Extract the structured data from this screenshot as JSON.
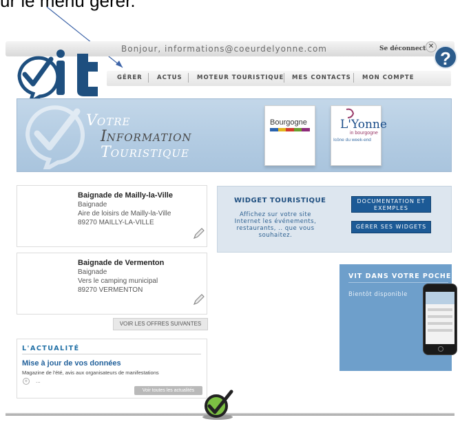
{
  "annotation": {
    "caption": "ur le menu gérer."
  },
  "header": {
    "greeting": "Bonjour, informations@coeurdelyonne.com",
    "logout_label": "Se déconnecter",
    "logout_icon": "close-icon",
    "help_label": "?",
    "logo_text": "Vit"
  },
  "nav": {
    "items": [
      {
        "label": "GÉRER"
      },
      {
        "label": "ACTUS"
      },
      {
        "label": "MOTEUR TOURISTIQUE"
      },
      {
        "label": "MES CONTACTS"
      },
      {
        "label": "MON COMPTE"
      }
    ]
  },
  "banner": {
    "tagline": [
      {
        "cap": "V",
        "rest": "OTRE"
      },
      {
        "cap": "I",
        "rest": "NFORMATION"
      },
      {
        "cap": "T",
        "rest": "OURISTIQUE"
      }
    ],
    "partner1": {
      "name": "Bourgogne",
      "colors": [
        "#2a63ad",
        "#e3b51f",
        "#d2392c",
        "#6b9e2e",
        "#8e2b7a"
      ]
    },
    "partner2": {
      "name": "L'Yonne",
      "subtitle_in": "in bourgogne",
      "tagline": "Icône du week-end"
    }
  },
  "listings": [
    {
      "title": "Baignade de Mailly-la-Ville",
      "type": "Baignade",
      "address": "Aire de loisirs de Mailly-la-Ville",
      "city": "89270 MAILLY-LA-VILLE"
    },
    {
      "title": "Baignade de Vermenton",
      "type": "Baignade",
      "address": "Vers le camping municipal",
      "city": "89270 VERMENTON"
    }
  ],
  "more_offers_label": "VOIR LES OFFRES SUIVANTES",
  "news": {
    "heading": "L'ACTUALITÉ",
    "title": "Mise à jour de vos données",
    "subtitle": "Magazine de l'été, avis aux organisateurs de manifestations",
    "expand_label": "+",
    "ellipsis": "...",
    "all_label": "Voir toutes les actualités"
  },
  "widget": {
    "title": "WIDGET TOURISTIQUE",
    "text": "Affichez sur votre site Internet les événements, restaurants, .. que vous souhaitez.",
    "doc_button": "DOCUMENTATION ET EXEMPLES",
    "manage_button": "GÉRER SES WIDGETS"
  },
  "mobile": {
    "title": "VIT DANS VOTRE POCHE",
    "subtitle": "Bientôt disponible"
  },
  "colors": {
    "brand_blue": "#1c5a96",
    "banner_blue": "#b2cbe2",
    "mobile_blue": "#6e9fcb",
    "check_green": "#7cc043"
  }
}
